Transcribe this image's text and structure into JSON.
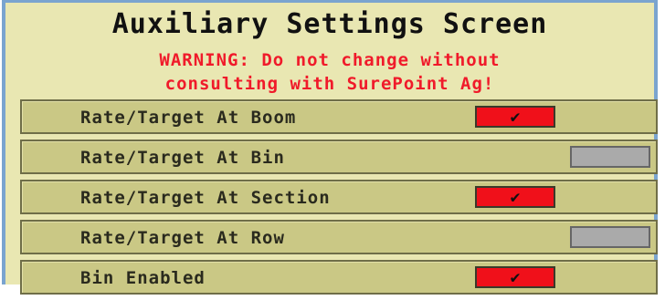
{
  "screen": {
    "title": "Auxiliary Settings Screen",
    "warning_line1": "WARNING: Do not change without",
    "warning_line2": "consulting with SurePoint Ag!"
  },
  "settings": [
    {
      "label": "Rate/Target At Boom",
      "enabled": true
    },
    {
      "label": "Rate/Target At Bin",
      "enabled": false
    },
    {
      "label": "Rate/Target At Section",
      "enabled": true
    },
    {
      "label": "Rate/Target At Row",
      "enabled": false
    },
    {
      "label": "Bin Enabled",
      "enabled": true
    }
  ],
  "icons": {
    "check": "✔"
  },
  "colors": {
    "on": "#f0101a",
    "off": "#aaaaaa",
    "warning": "#f01a2a",
    "background": "#e9e7b2"
  }
}
